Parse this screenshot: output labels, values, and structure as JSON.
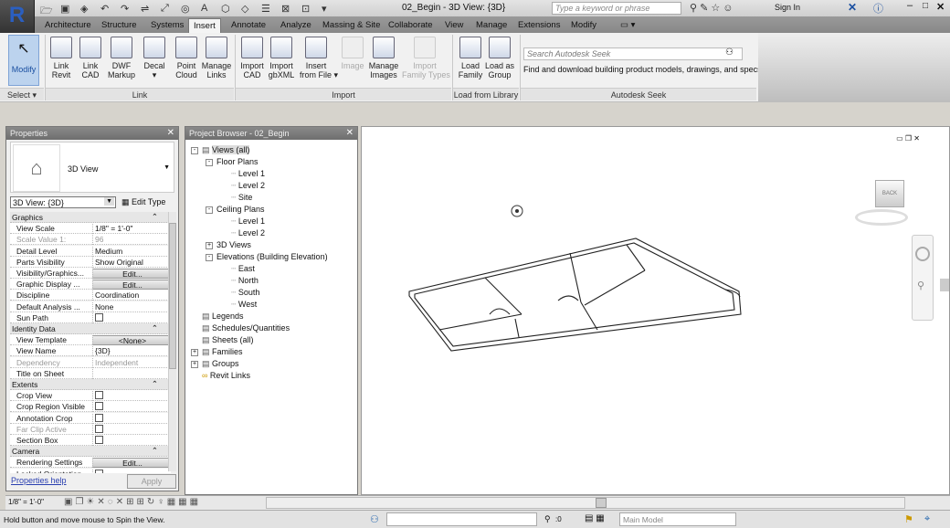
{
  "app": {
    "logo": "R",
    "title": "02_Begin - 3D View: {3D}",
    "search_placeholder": "Type a keyword or phrase",
    "sign_in": "Sign In"
  },
  "quick_access": [
    "open-icon",
    "save-icon",
    "sync-icon",
    "undo-icon",
    "redo-icon",
    "align-icon",
    "measure-icon",
    "tag-icon",
    "text-icon",
    "3d-view-icon",
    "section-icon",
    "thin-lines-icon",
    "close-windows-icon",
    "switch-windows-icon",
    "customize-icon"
  ],
  "tabs": [
    "Architecture",
    "Structure",
    "Systems",
    "Insert",
    "Annotate",
    "Analyze",
    "Massing & Site",
    "Collaborate",
    "View",
    "Manage",
    "Extensions",
    "Modify"
  ],
  "active_tab": "Insert",
  "ribbon": {
    "modify": "Modify",
    "select": "Select ▾",
    "link_buttons": [
      {
        "label": "Link\nRevit"
      },
      {
        "label": "Link\nCAD"
      },
      {
        "label": "DWF\nMarkup"
      },
      {
        "label": "Decal\n▾"
      },
      {
        "label": "Point\nCloud"
      },
      {
        "label": "Manage\nLinks"
      }
    ],
    "import_buttons": [
      {
        "label": "Import\nCAD",
        "enabled": true
      },
      {
        "label": "Import\ngbXML",
        "enabled": true
      },
      {
        "label": "Insert\nfrom File ▾",
        "enabled": true
      },
      {
        "label": "Image",
        "enabled": false
      },
      {
        "label": "Manage\nImages",
        "enabled": true
      },
      {
        "label": "Import\nFamily Types",
        "enabled": false
      }
    ],
    "library_buttons": [
      {
        "label": "Load\nFamily"
      },
      {
        "label": "Load as\nGroup"
      }
    ],
    "panels": {
      "link": "Link",
      "import": "Import",
      "library": "Load from Library",
      "seek": "Autodesk Seek"
    },
    "seek_placeholder": "Search Autodesk Seek",
    "seek_description": "Find and download building product models, drawings, and specs"
  },
  "properties": {
    "title": "Properties",
    "type_name": "3D View",
    "type_selector": "3D View: {3D}",
    "edit_type": "Edit Type",
    "rows": [
      {
        "group": "Graphics"
      },
      {
        "k": "View Scale",
        "v": "1/8\" = 1'-0\""
      },
      {
        "k": "Scale Value    1:",
        "v": "96",
        "dim": true
      },
      {
        "k": "Detail Level",
        "v": "Medium"
      },
      {
        "k": "Parts Visibility",
        "v": "Show Original"
      },
      {
        "k": "Visibility/Graphics...",
        "v": "Edit...",
        "btn": true
      },
      {
        "k": "Graphic Display ...",
        "v": "Edit...",
        "btn": true
      },
      {
        "k": "Discipline",
        "v": "Coordination"
      },
      {
        "k": "Default Analysis ...",
        "v": "None"
      },
      {
        "k": "Sun Path",
        "check": false
      },
      {
        "group": "Identity Data"
      },
      {
        "k": "View Template",
        "v": "<None>",
        "btn": true
      },
      {
        "k": "View Name",
        "v": "{3D}"
      },
      {
        "k": "Dependency",
        "v": "Independent",
        "dim": true
      },
      {
        "k": "Title on Sheet",
        "v": ""
      },
      {
        "group": "Extents"
      },
      {
        "k": "Crop View",
        "check": false
      },
      {
        "k": "Crop Region Visible",
        "check": false
      },
      {
        "k": "Annotation Crop",
        "check": false
      },
      {
        "k": "Far Clip Active",
        "check": false,
        "dim": true
      },
      {
        "k": "Section Box",
        "check": false
      },
      {
        "group": "Camera"
      },
      {
        "k": "Rendering Settings",
        "v": "Edit...",
        "btn": true
      },
      {
        "k": "Locked Orientation",
        "check": false
      }
    ],
    "help": "Properties help",
    "apply": "Apply"
  },
  "browser": {
    "title": "Project Browser - 02_Begin",
    "items": [
      {
        "label": "Views (all)",
        "level": 0,
        "exp": "-"
      },
      {
        "label": "Floor Plans",
        "level": 1,
        "exp": "-"
      },
      {
        "label": "Level 1",
        "level": 2
      },
      {
        "label": "Level 2",
        "level": 2
      },
      {
        "label": "Site",
        "level": 2
      },
      {
        "label": "Ceiling Plans",
        "level": 1,
        "exp": "-"
      },
      {
        "label": "Level 1",
        "level": 2
      },
      {
        "label": "Level 2",
        "level": 2
      },
      {
        "label": "3D Views",
        "level": 1,
        "exp": "+"
      },
      {
        "label": "Elevations (Building Elevation)",
        "level": 1,
        "exp": "-"
      },
      {
        "label": "East",
        "level": 2
      },
      {
        "label": "North",
        "level": 2
      },
      {
        "label": "South",
        "level": 2
      },
      {
        "label": "West",
        "level": 2
      },
      {
        "label": "Legends",
        "level": 0
      },
      {
        "label": "Schedules/Quantities",
        "level": 0
      },
      {
        "label": "Sheets (all)",
        "level": 0
      },
      {
        "label": "Families",
        "level": 0,
        "exp": "+"
      },
      {
        "label": "Groups",
        "level": 0,
        "exp": "+"
      },
      {
        "label": "Revit Links",
        "level": 0
      }
    ]
  },
  "view": {
    "viewcube_face": "BACK"
  },
  "view_bar": {
    "scale": "1/8\" = 1'-0\""
  },
  "status": {
    "message": "Hold button and move mouse to Spin the View.",
    "worksets": ":0",
    "model": "Main Model"
  }
}
